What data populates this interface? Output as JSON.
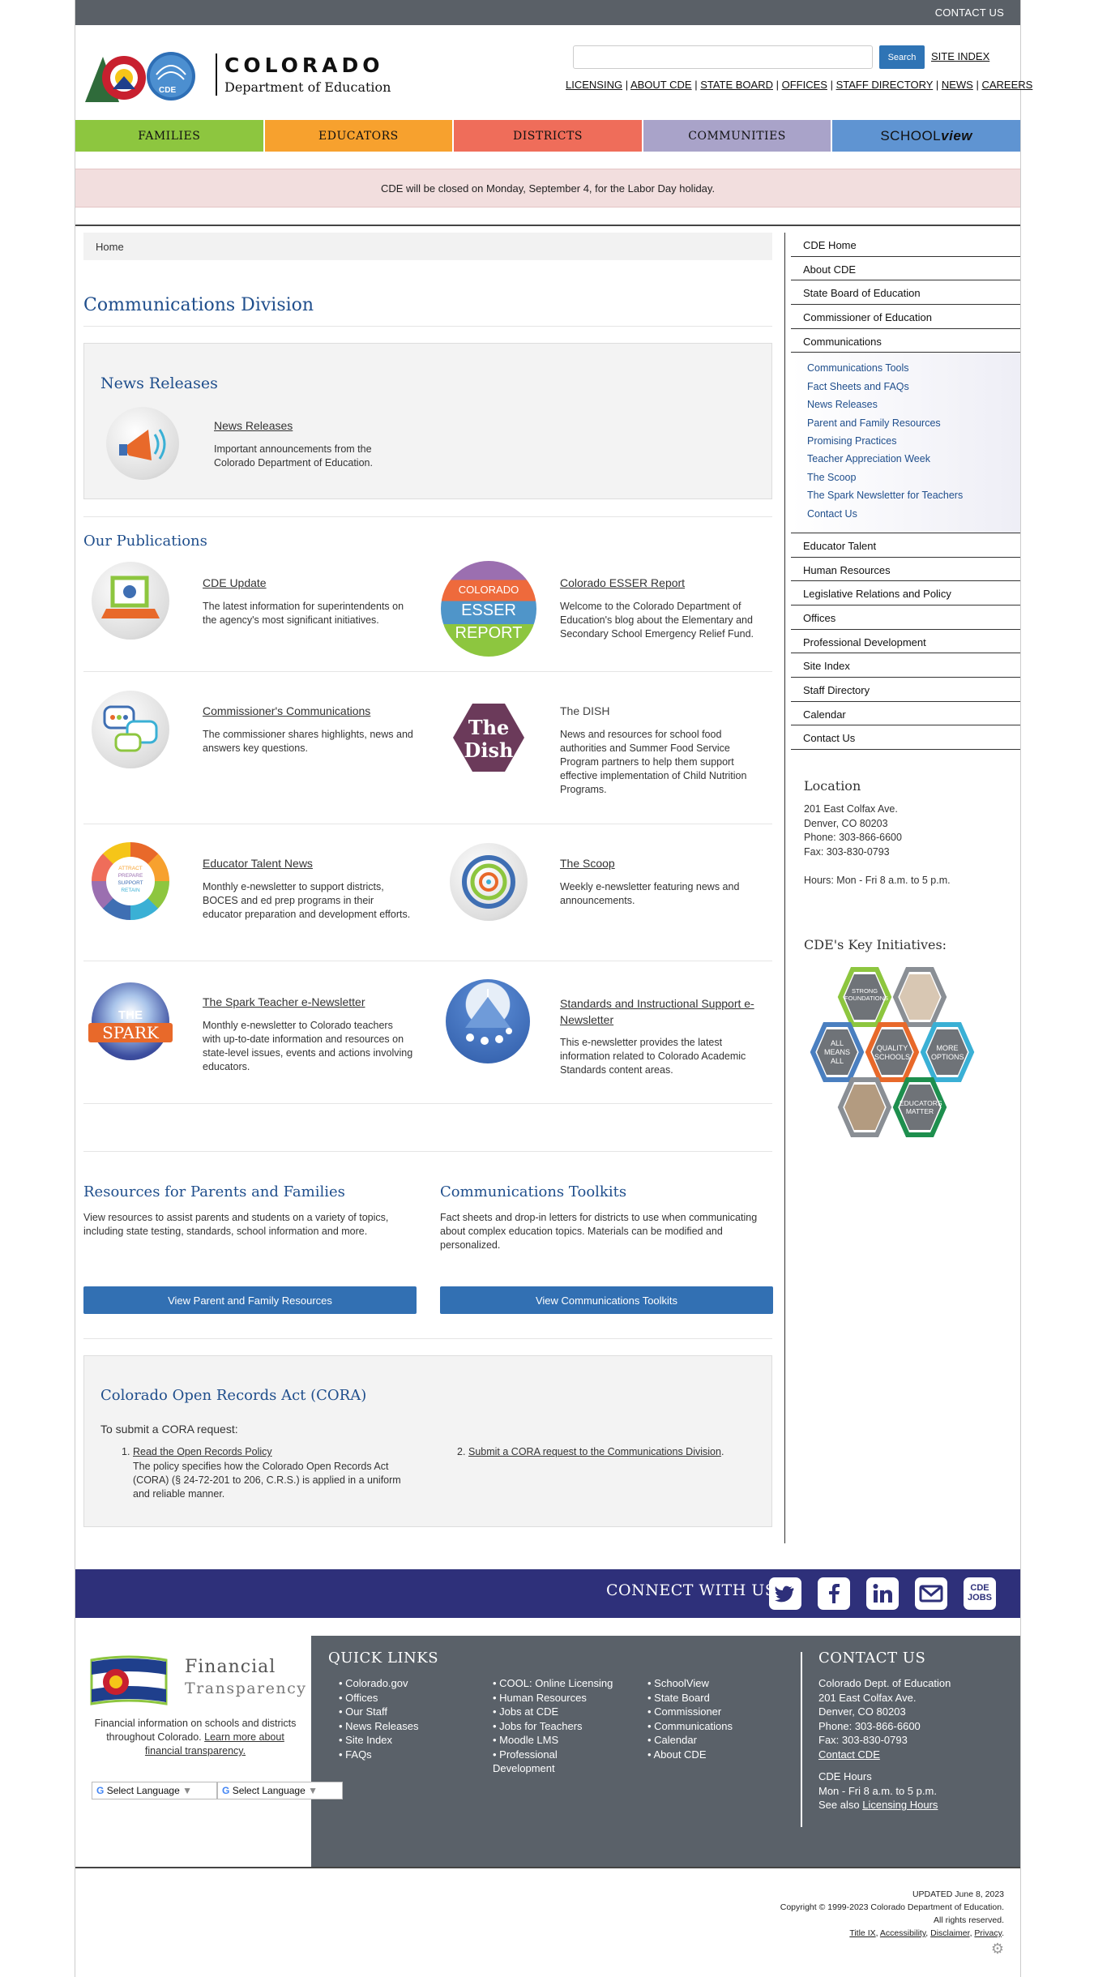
{
  "topbar": {
    "contact": "CONTACT US"
  },
  "header": {
    "logo_title": "COLORADO",
    "logo_sub": "Department of Education",
    "logo_badge": "CDE",
    "search_button": "Search",
    "site_index": "SITE INDEX",
    "util_links": [
      "LICENSING",
      "ABOUT CDE",
      "STATE BOARD",
      "OFFICES",
      "STAFF DIRECTORY",
      "NEWS",
      "CAREERS"
    ]
  },
  "nav": {
    "items": [
      {
        "label": "FAMILIES",
        "color": "#8dc63f"
      },
      {
        "label": "EDUCATORS",
        "color": "#f7a12e"
      },
      {
        "label": "DISTRICTS",
        "color": "#ef6d5a"
      },
      {
        "label": "COMMUNITIES",
        "color": "#a9a3c9"
      },
      {
        "label_a": "SCHOOL",
        "label_b": "view",
        "color": "#5f94d2"
      }
    ]
  },
  "alert": "CDE will be closed on Monday, September 4, for the Labor Day holiday.",
  "breadcrumb": "Home",
  "page_title": "Communications Division",
  "news_releases": {
    "heading": "News Releases",
    "link": "News Releases",
    "desc": "Important announcements from the Colorado Department of Education."
  },
  "publications": {
    "heading": "Our Publications",
    "items": [
      {
        "title": "CDE Update",
        "desc": "The latest information for superintendents on the agency's most significant initiatives.",
        "link": true
      },
      {
        "title": "Colorado ESSER Report",
        "desc": "Welcome to the Colorado Department of Education's blog about the Elementary and Secondary School Emergency Relief Fund.",
        "link": true,
        "badge": [
          "COLORADO",
          "ESSER",
          "REPORT"
        ]
      },
      {
        "title": "Commissioner's Communications",
        "desc": "The commissioner shares highlights, news and answers key questions.",
        "link": true
      },
      {
        "title": "The DISH",
        "desc": "News and resources for school food authorities and Summer Food Service Program partners to help them support effective implementation of Child Nutrition Programs.",
        "link": false,
        "badge": [
          "The",
          "Dish"
        ]
      },
      {
        "title": "Educator Talent News",
        "desc": "Monthly e-newsletter to support districts, BOCES and ed prep programs in their educator preparation and development efforts.",
        "link": true,
        "badge": [
          "ATTRACT",
          "PREPARE",
          "SUPPORT",
          "RETAIN"
        ]
      },
      {
        "title": "The Scoop",
        "desc": "Weekly e-newsletter featuring news and announcements.",
        "link": true
      },
      {
        "title": "The Spark Teacher e-Newsletter",
        "desc": "Monthly e-newsletter to Colorado teachers with up-to-date information and resources on state-level issues, events and actions involving educators.",
        "link": true,
        "badge": [
          "THE",
          "SPARK"
        ]
      },
      {
        "title": "Standards and Instructional Support e-Newsletter",
        "desc": "This e-newsletter provides the latest information related to Colorado Academic Standards content areas.",
        "link": true
      }
    ]
  },
  "resources": {
    "heading": "Resources for Parents and Families",
    "desc": "View resources to assist parents and students on a variety of topics, including state testing, standards, school information and more.",
    "button": "View Parent and Family Resources"
  },
  "toolkits": {
    "heading": "Communications Toolkits",
    "desc": "Fact sheets and drop-in letters for districts to use when communicating about complex education topics. Materials can be modified and personalized.",
    "button": "View Communications Toolkits"
  },
  "cora": {
    "heading": "Colorado Open Records Act (CORA)",
    "intro": "To submit a CORA request:",
    "item1_num": "1.",
    "item1_link": "Read the Open Records Policy",
    "item1_desc": "The policy specifies how the Colorado Open Records Act (CORA) (§ 24-72-201 to 206, C.R.S.) is applied in a uniform and reliable manner.",
    "item2_num": "2.",
    "item2_link": "Submit a CORA request to the Communications Division",
    "item2_end": "."
  },
  "sidebar": {
    "top_items": [
      "CDE Home",
      "About CDE",
      "State Board of Education",
      "Commissioner of Education",
      "Communications"
    ],
    "sub_items": [
      "Communications Tools",
      "Fact Sheets and FAQs",
      "News Releases",
      "Parent and Family Resources",
      "Promising Practices",
      "Teacher Appreciation Week",
      "The Scoop",
      "The Spark Newsletter for Teachers",
      "Contact Us"
    ],
    "bottom_items": [
      "Educator Talent",
      "Human Resources",
      "Legislative Relations and Policy",
      "Offices",
      "Professional Development",
      "Site Index",
      "Staff Directory",
      "Calendar",
      "Contact Us"
    ],
    "location_heading": "Location",
    "address": [
      "201 East Colfax Ave.",
      "Denver, CO 80203",
      "Phone: 303-866-6600",
      "Fax: 303-830-0793"
    ],
    "hours": "Hours: Mon - Fri 8 a.m. to 5 p.m.",
    "initiatives_heading": "CDE's Key Initiatives:",
    "initiatives": [
      "STRONG FOUNDATIONS",
      "ALL MEANS ALL",
      "QUALITY SCHOOLS",
      "MORE OPTIONS",
      "EDUCATORS MATTER"
    ]
  },
  "connect": {
    "label": "CONNECT WITH US",
    "jobs_a": "CDE",
    "jobs_b": "JOBS"
  },
  "footer": {
    "fin_title_a": "Financial",
    "fin_title_b": "Transparency",
    "fin_desc": "Financial information on schools and districts throughout Colorado.",
    "fin_link": "Learn more about financial transparency.",
    "select_language": "Select Language",
    "quick_links_heading": "QUICK LINKS",
    "col1": [
      "Colorado.gov",
      "Offices",
      "Our Staff",
      "News Releases",
      "Site Index",
      "FAQs"
    ],
    "col2": [
      "COOL: Online Licensing",
      "Human Resources",
      "Jobs at CDE",
      "Jobs for Teachers",
      "Moodle LMS",
      "Professional Development"
    ],
    "col3": [
      "SchoolView",
      "State Board",
      "Commissioner",
      "Communications",
      "Calendar",
      "About CDE"
    ],
    "contact_heading": "CONTACT US",
    "contact_lines": [
      "Colorado Dept. of Education",
      "201 East Colfax Ave.",
      "Denver, CO 80203",
      "Phone: 303-866-6600",
      "Fax: 303-830-0793"
    ],
    "contact_link": "Contact CDE",
    "hours_heading": "CDE Hours",
    "hours": "Mon - Fri 8 a.m. to 5 p.m.",
    "see_also": "See also",
    "licensing_hours": "Licensing Hours"
  },
  "bottom": {
    "updated": "UPDATED June 8, 2023",
    "copyright": "Copyright © 1999-2023 Colorado Department of Education.",
    "rights": "All rights reserved.",
    "links": [
      "Title IX",
      "Accessibility",
      "Disclaimer",
      "Privacy"
    ]
  }
}
